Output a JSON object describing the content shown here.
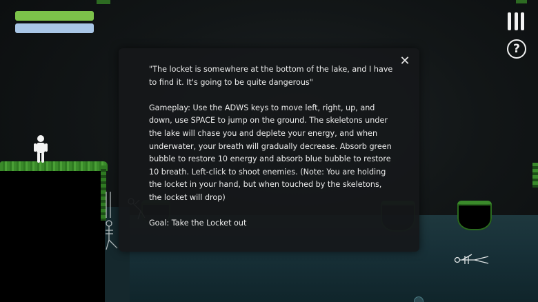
{
  "hud": {
    "energy_color": "#7cc24a",
    "energy_level": 1.0,
    "breath_color": "#a9c6e6",
    "breath_level": 1.0,
    "menu_icon": "pause-bars-icon",
    "help_label": "?"
  },
  "modal": {
    "close_label": "✕",
    "quote": "\"The locket is somewhere at the bottom of the lake, and I have to find it. It's going to be quite dangerous\"",
    "gameplay": "Gameplay: Use the ADWS keys to move left, right, up, and down, use SPACE to jump on the ground. The skeletons under the lake will chase you and deplete your energy, and when underwater, your breath will gradually decrease. Absorb green bubble to restore 10 energy and absorb blue bubble to restore 10 breath. Left-click to shoot enemies. (Note: You are holding the locket in your hand, but when touched by the skeletons, the locket will drop)",
    "goal": "Goal: Take the Locket out"
  },
  "colors": {
    "grass": "#3a8a2a",
    "water": "#1f3a40",
    "background": "#121617"
  }
}
